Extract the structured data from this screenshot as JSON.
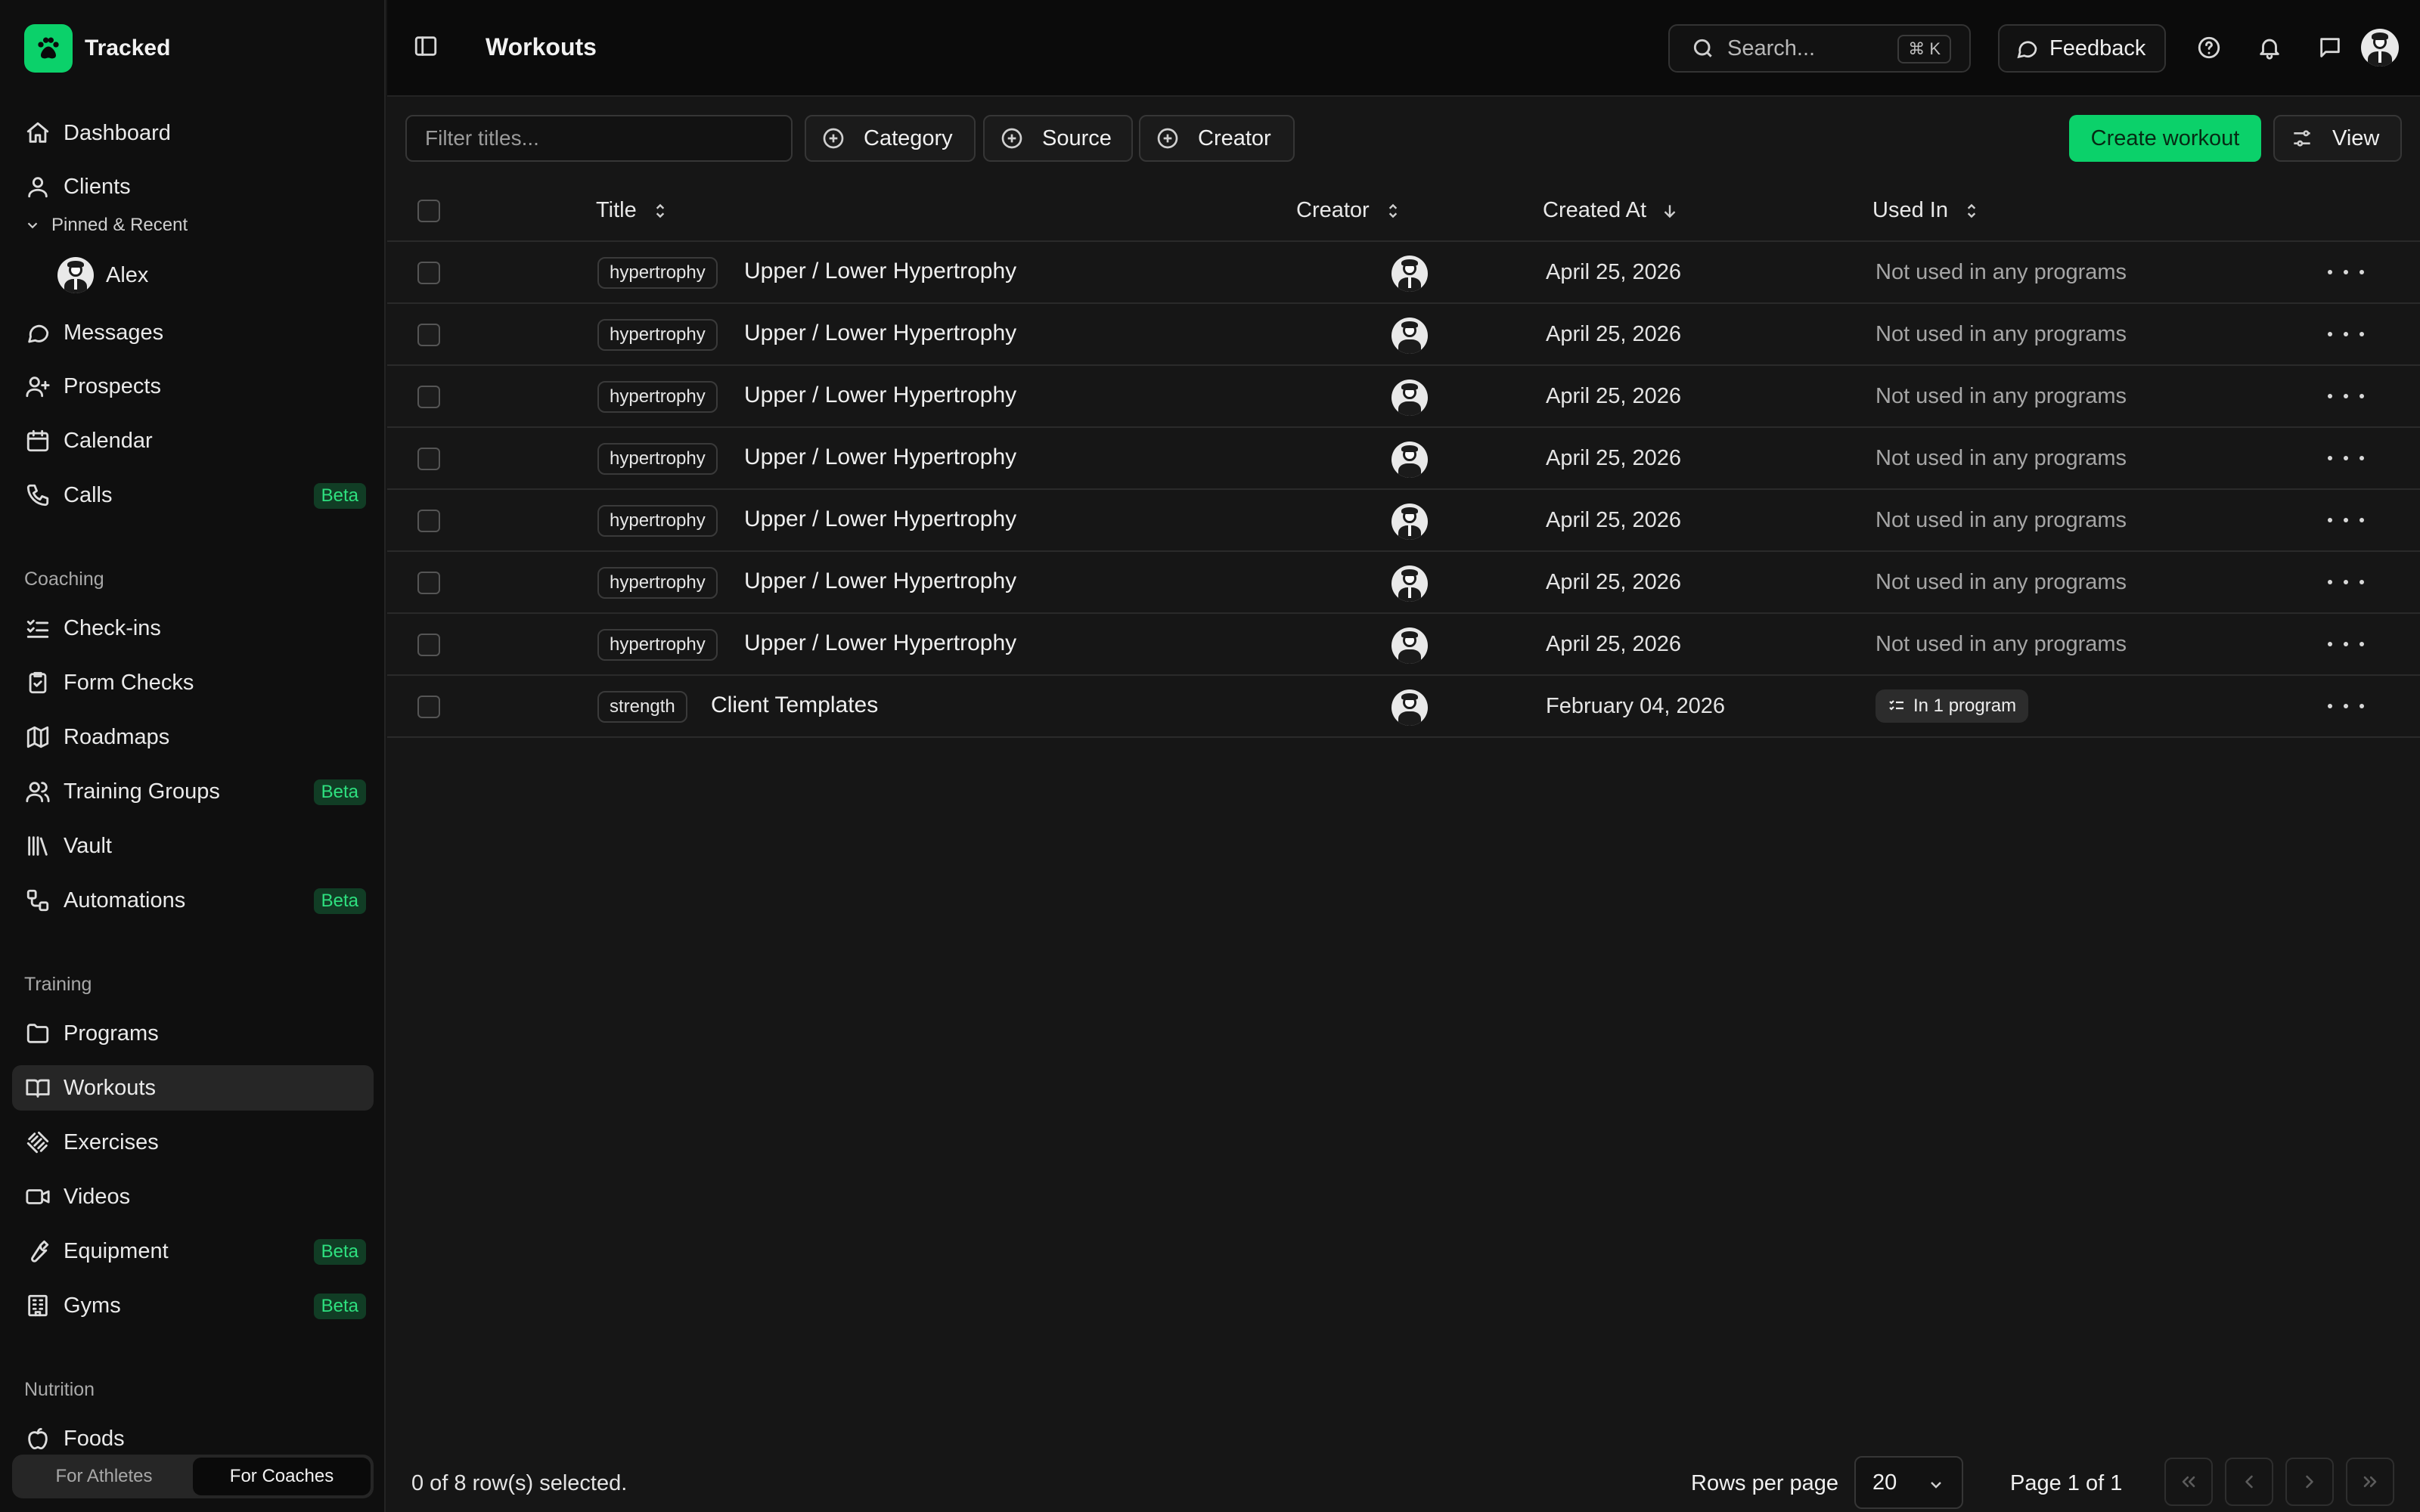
{
  "brand": {
    "name": "Tracked"
  },
  "sidebar": {
    "nav": [
      {
        "label": "Dashboard",
        "icon": "home-icon"
      },
      {
        "label": "Clients",
        "icon": "user-icon"
      }
    ],
    "pinned_label": "Pinned & Recent",
    "pinned_user": {
      "name": "Alex"
    },
    "nav2": [
      {
        "label": "Messages",
        "icon": "message-icon"
      },
      {
        "label": "Prospects",
        "icon": "user-plus-icon"
      },
      {
        "label": "Calendar",
        "icon": "calendar-icon"
      },
      {
        "label": "Calls",
        "icon": "phone-icon",
        "badge": "Beta"
      }
    ],
    "coaching_label": "Coaching",
    "coaching": [
      {
        "label": "Check-ins",
        "icon": "checklist-icon"
      },
      {
        "label": "Form Checks",
        "icon": "clipboard-check-icon"
      },
      {
        "label": "Roadmaps",
        "icon": "map-icon"
      },
      {
        "label": "Training Groups",
        "icon": "users-icon",
        "badge": "Beta"
      },
      {
        "label": "Vault",
        "icon": "library-icon"
      },
      {
        "label": "Automations",
        "icon": "workflow-icon",
        "badge": "Beta"
      }
    ],
    "training_label": "Training",
    "training": [
      {
        "label": "Programs",
        "icon": "folder-icon"
      },
      {
        "label": "Workouts",
        "icon": "book-open-icon",
        "active": true
      },
      {
        "label": "Exercises",
        "icon": "dumbbell-icon"
      },
      {
        "label": "Videos",
        "icon": "video-icon"
      },
      {
        "label": "Equipment",
        "icon": "wrench-icon",
        "badge": "Beta"
      },
      {
        "label": "Gyms",
        "icon": "building-icon",
        "badge": "Beta"
      }
    ],
    "nutrition_label": "Nutrition",
    "nutrition": [
      {
        "label": "Foods",
        "icon": "apple-icon"
      }
    ],
    "mode": {
      "athletes": "For Athletes",
      "coaches": "For Coaches",
      "active": "coaches"
    }
  },
  "topbar": {
    "title": "Workouts",
    "search_placeholder": "Search...",
    "search_shortcut": "⌘ K",
    "feedback_label": "Feedback"
  },
  "toolbar": {
    "filter_placeholder": "Filter titles...",
    "chips": [
      "Category",
      "Source",
      "Creator"
    ],
    "create_label": "Create workout",
    "view_label": "View"
  },
  "table": {
    "columns": {
      "title": "Title",
      "creator": "Creator",
      "created_at": "Created At",
      "used_in": "Used In"
    },
    "rows": [
      {
        "tag": "hypertrophy",
        "title": "Upper / Lower Hypertrophy",
        "created": "April 25, 2026",
        "used": "Not used in any programs"
      },
      {
        "tag": "hypertrophy",
        "title": "Upper / Lower Hypertrophy",
        "created": "April 25, 2026",
        "used": "Not used in any programs"
      },
      {
        "tag": "hypertrophy",
        "title": "Upper / Lower Hypertrophy",
        "created": "April 25, 2026",
        "used": "Not used in any programs"
      },
      {
        "tag": "hypertrophy",
        "title": "Upper / Lower Hypertrophy",
        "created": "April 25, 2026",
        "used": "Not used in any programs"
      },
      {
        "tag": "hypertrophy",
        "title": "Upper / Lower Hypertrophy",
        "created": "April 25, 2026",
        "used": "Not used in any programs"
      },
      {
        "tag": "hypertrophy",
        "title": "Upper / Lower Hypertrophy",
        "created": "April 25, 2026",
        "used": "Not used in any programs"
      },
      {
        "tag": "hypertrophy",
        "title": "Upper / Lower Hypertrophy",
        "created": "April 25, 2026",
        "used": "Not used in any programs"
      },
      {
        "tag": "strength",
        "title": "Client Templates",
        "created": "February 04, 2026",
        "used_badge": "In 1 program"
      }
    ]
  },
  "footer": {
    "selection": "0 of 8 row(s) selected.",
    "rows_per_page_label": "Rows per page",
    "rows_per_page": "20",
    "page_info": "Page 1 of 1"
  },
  "colors": {
    "accent": "#0bd16a",
    "background": "#161616",
    "sidebar": "#0f0f0f"
  }
}
